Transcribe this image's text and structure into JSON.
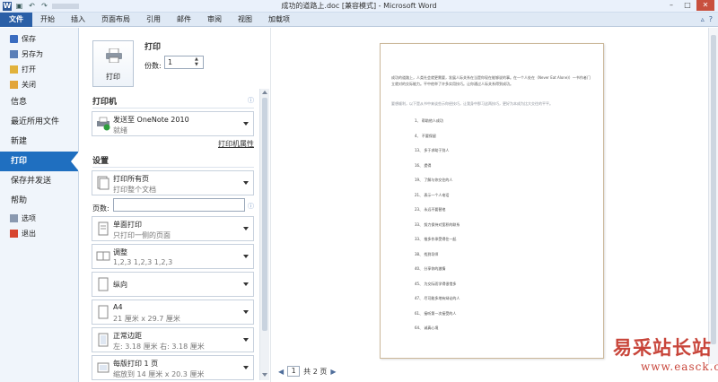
{
  "window": {
    "title": "成功的道路上.doc [兼容模式] - Microsoft Word",
    "app_icon": "W",
    "qat": [
      "save-icon",
      "undo-icon",
      "redo-icon"
    ],
    "buttons": {
      "min": "–",
      "max": "□",
      "close": "✕"
    }
  },
  "ribbon": {
    "tabs": [
      "文件",
      "开始",
      "插入",
      "页面布局",
      "引用",
      "邮件",
      "审阅",
      "视图",
      "加载项"
    ],
    "right_icons": [
      "▵",
      "?"
    ]
  },
  "nav": {
    "items_top": [
      "保存",
      "另存为",
      "打开",
      "关闭"
    ],
    "sections": [
      "信息",
      "最近所用文件",
      "新建",
      "打印",
      "保存并发送",
      "帮助"
    ],
    "items_bottom": [
      "选项",
      "退出"
    ]
  },
  "print": {
    "title": "打印",
    "button_label": "打印",
    "copies_label": "份数:",
    "copies_value": "1",
    "printer_section": "打印机",
    "printer_name": "发送至 OneNote 2010",
    "printer_status": "就绪",
    "printer_properties": "打印机属性",
    "settings_section": "设置",
    "pages_label": "页数:",
    "settings": [
      {
        "t1": "打印所有页",
        "t2": "打印整个文档"
      },
      {
        "t1": "单面打印",
        "t2": "只打印一侧的页面"
      },
      {
        "t1": "调整",
        "t2": "1,2,3     1,2,3     1,2,3"
      },
      {
        "t1": "纵向",
        "t2": ""
      },
      {
        "t1": "A4",
        "t2": "21 厘米 x 29.7 厘米"
      },
      {
        "t1": "正常边距",
        "t2": "左: 3.18 厘米    右: 3.18 厘米"
      },
      {
        "t1": "每版打印 1 页",
        "t2": "缩放到 14 厘米 x 20.3 厘米"
      }
    ]
  },
  "preview": {
    "intro": "成功的道路上，人类社会就更需要，发展人际关系在当是你现在能够说的事。在一个人处在（Never Eat Alone)）一书作者门立就对的交际能力。平中他举了许多实用技巧。让你通过人际关系得到成功。",
    "intro2": "要想顺利，以下是从书中来谈些示你经技巧，让我身中那习这两技巧，更好为本成为比大交往的平平。",
    "items": [
      "1、 帮助他人成功",
      "4、 不要保留",
      "13、 多于求助于别人",
      "16、 提得",
      "19、 了解与你交往的人",
      "21、 表示一个人电话",
      "23、 永远不要替他",
      "33、 努力保持对宽积的联系",
      "33、 推多作承受得住一起",
      "38、 找到导师",
      "40、 分享你的激情",
      "45、 为交际而学得很惜多",
      "47、 尽可能多地有辩论的人",
      "61、 接听第一次接受的人",
      "64、 诚真心境"
    ],
    "page_number": "1",
    "page_total": "共 2 页"
  },
  "watermark": {
    "line1": "易采站长站",
    "line2": "www.easck.com",
    "color": "#c8453a"
  }
}
